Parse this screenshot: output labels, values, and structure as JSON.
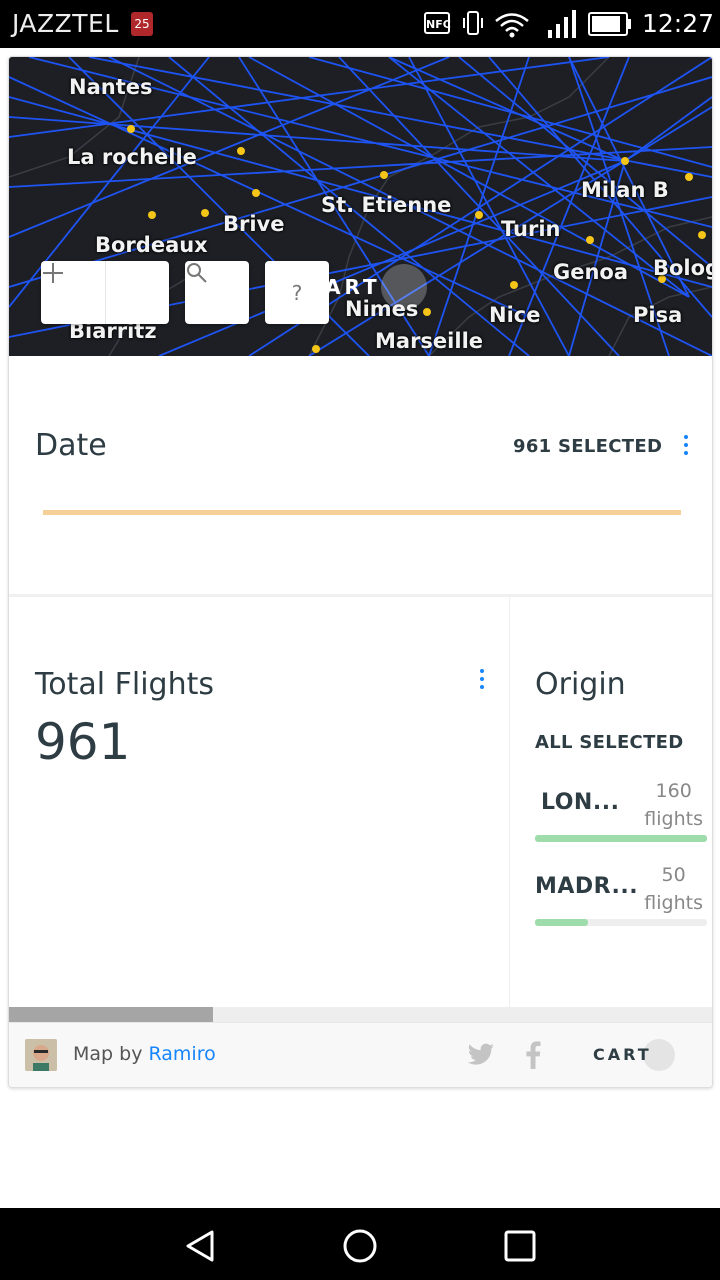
{
  "status_bar": {
    "carrier": "JAZZTEL",
    "calendar_badge": "25",
    "nfc_label": "NFC",
    "time": "12:27",
    "icons": [
      "calendar-icon",
      "nfc-icon",
      "vibrate-icon",
      "wifi-icon",
      "signal-icon",
      "battery-icon"
    ]
  },
  "map": {
    "cities": [
      {
        "name": "Nantes"
      },
      {
        "name": "La rochelle"
      },
      {
        "name": "Brive"
      },
      {
        "name": "Bordeaux"
      },
      {
        "name": "St. Etienne"
      },
      {
        "name": "Turin"
      },
      {
        "name": "Milan B"
      },
      {
        "name": "Genoa"
      },
      {
        "name": "Bolog"
      },
      {
        "name": "Biarritz"
      },
      {
        "name": "Nimes"
      },
      {
        "name": "Nice"
      },
      {
        "name": "Pisa"
      },
      {
        "name": "Marseille"
      }
    ],
    "zoom_out_icon": "minus-icon",
    "zoom_in_icon": "plus-icon",
    "search_icon": "search-icon",
    "help_label": "?",
    "carto_logo": "ART",
    "route_color": "#1f57ff",
    "airport_color": "#f5c518"
  },
  "date_widget": {
    "title": "Date",
    "selected": "961 SELECTED",
    "bar_color": "#f6d098"
  },
  "total_widget": {
    "title": "Total Flights",
    "value": "961"
  },
  "origin_widget": {
    "title": "Origin",
    "selected": "ALL SELECTED",
    "categories": [
      {
        "name": "LON...",
        "count": "160",
        "unit": "flights",
        "fraction": 1.0
      },
      {
        "name": "MADR...",
        "count": "50",
        "unit": "flights",
        "fraction": 0.31
      }
    ],
    "bar_color": "#9fdcab"
  },
  "footer": {
    "prefix": "Map by",
    "author": "Ramiro",
    "carto": "CART"
  },
  "nav_bar": {
    "icons": [
      "back-icon",
      "home-icon",
      "recents-icon"
    ]
  }
}
